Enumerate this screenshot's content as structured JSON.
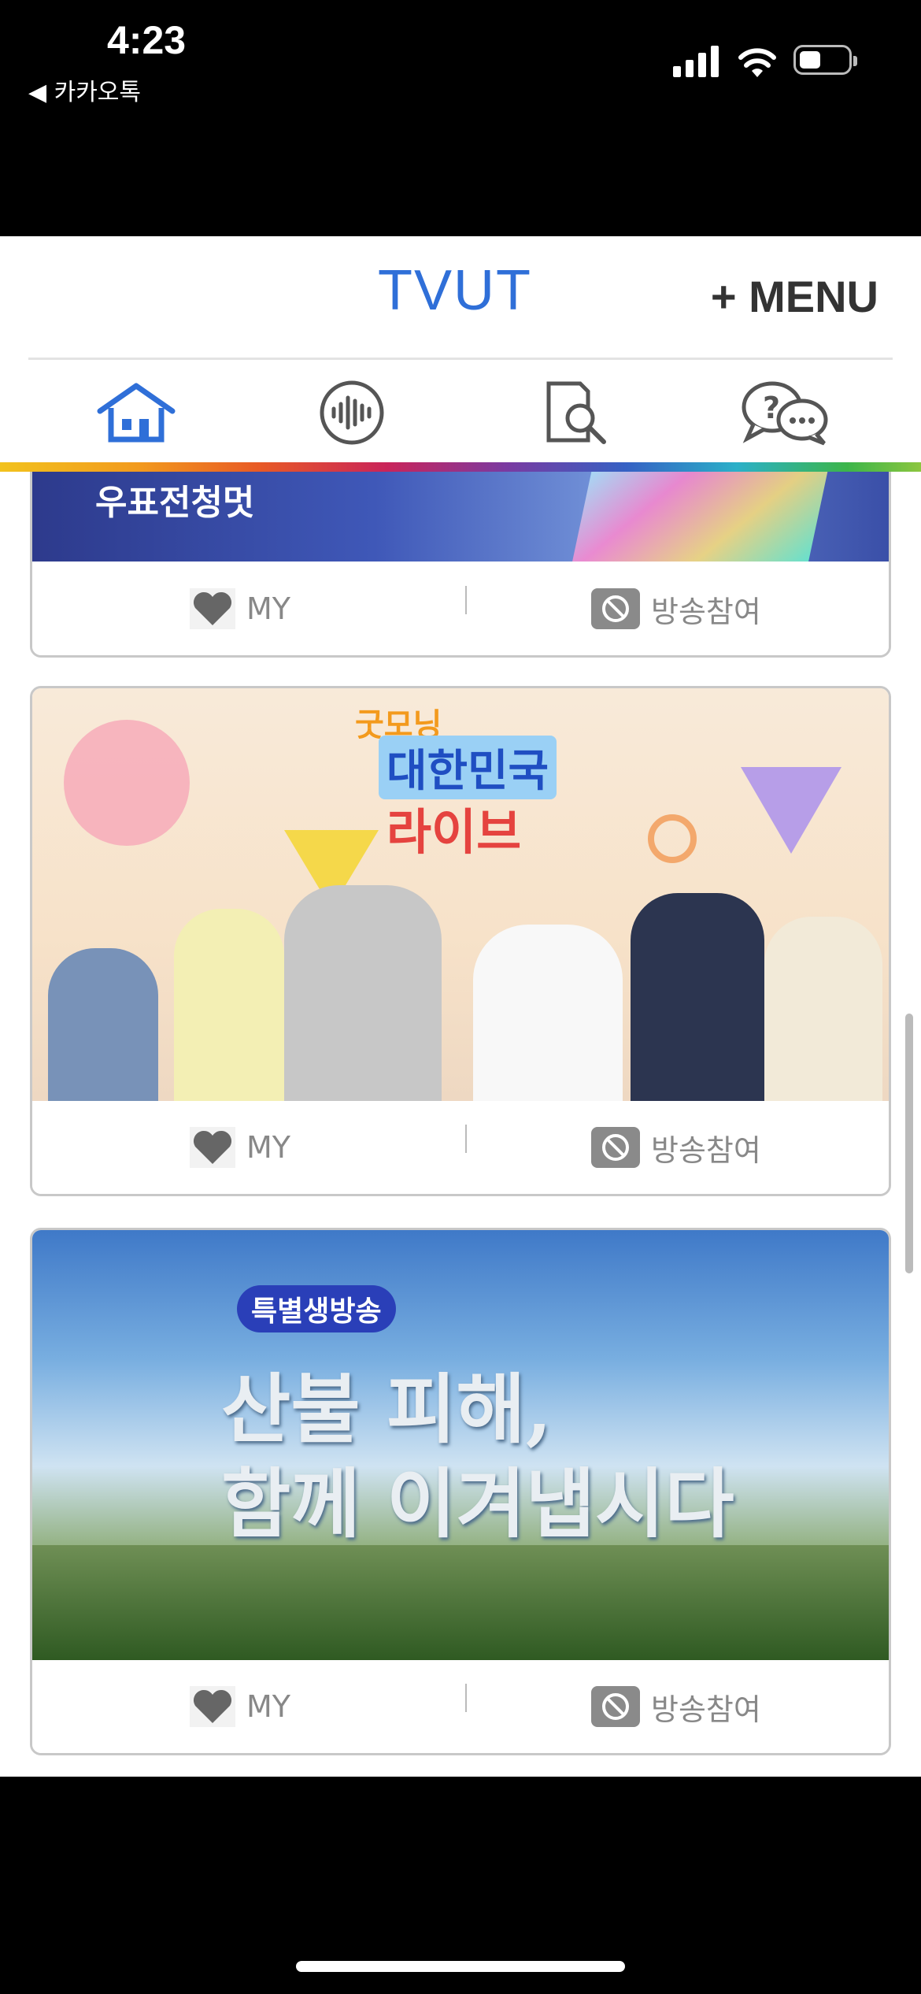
{
  "status_bar": {
    "time": "4:23",
    "back_label": "◀ 카카오톡"
  },
  "header": {
    "logo": "TVUT",
    "menu_label": "+ MENU"
  },
  "nav": {
    "items": [
      {
        "icon": "home-icon"
      },
      {
        "icon": "audio-wave-icon"
      },
      {
        "icon": "document-search-icon"
      },
      {
        "icon": "question-chat-icon"
      }
    ]
  },
  "cards": [
    {
      "image_text": "우표전청멋",
      "actions": {
        "my_label": "MY",
        "participate_label": "방송참여"
      }
    },
    {
      "image_text": {
        "top": "굿모닝",
        "mid": "대한민국",
        "bottom": "라이브"
      },
      "actions": {
        "my_label": "MY",
        "participate_label": "방송참여"
      }
    },
    {
      "image_text": {
        "badge": "특별생방송",
        "line1": "산불 피해,",
        "line2": "함께 이겨냅시다"
      },
      "actions": {
        "my_label": "MY",
        "participate_label": "방송참여"
      }
    }
  ],
  "colors": {
    "brand": "#2f6fd8",
    "card_border": "#c8c8c8",
    "muted_text": "#888888"
  }
}
